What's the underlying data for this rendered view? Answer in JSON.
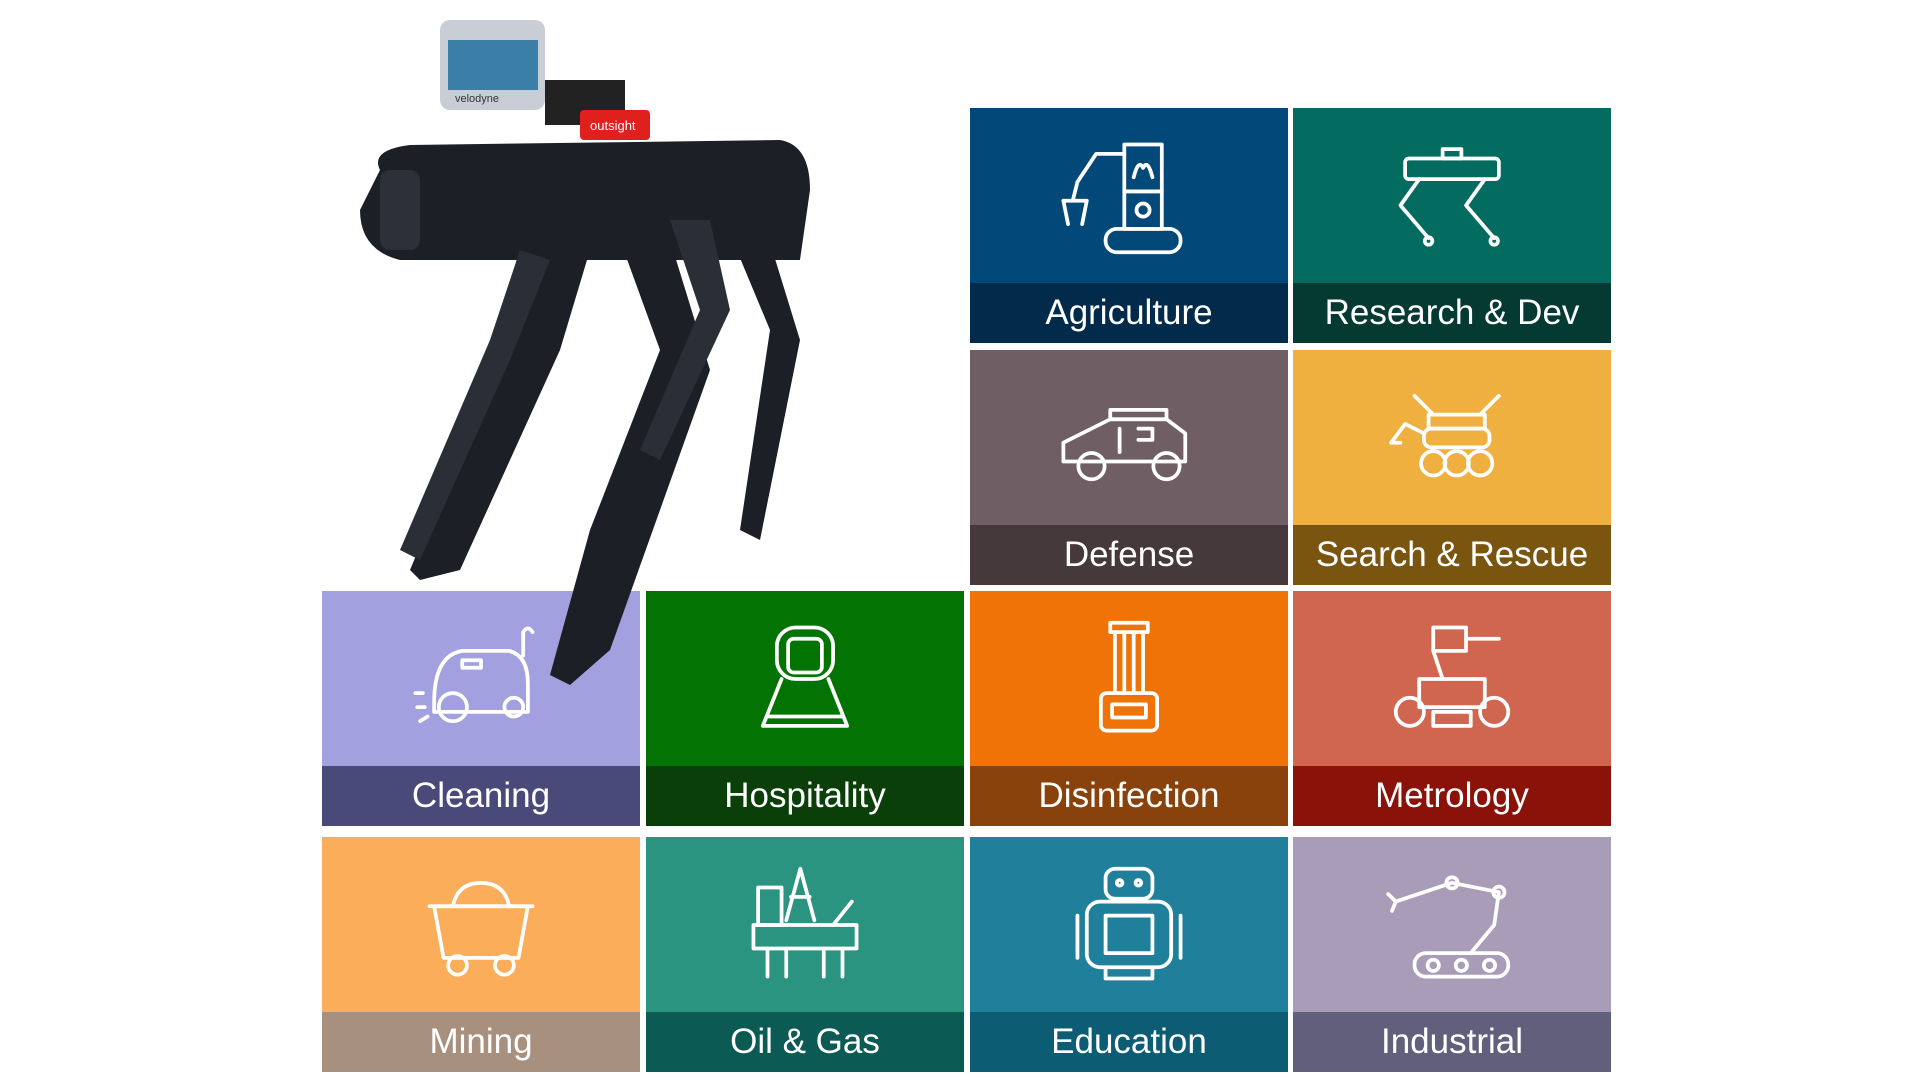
{
  "robot": {
    "lidar_brand": "velodyne",
    "sensor_brand": "outsight"
  },
  "tiles": [
    {
      "label": "Agriculture",
      "icon": "agriculture-robot-icon",
      "color": "#02497a",
      "band": "#022a4a"
    },
    {
      "label": "Research & Dev",
      "icon": "quadruped-robot-icon",
      "color": "#036b5f",
      "band": "#053a32"
    },
    {
      "label": "Defense",
      "icon": "military-vehicle-icon",
      "color": "#6f5f64",
      "band": "#45393c"
    },
    {
      "label": "Search & Rescue",
      "icon": "rover-robot-icon",
      "color": "#f0b040",
      "band": "#7a5510"
    },
    {
      "label": "Cleaning",
      "icon": "cleaning-robot-icon",
      "color": "#a3a0e0",
      "band": "#4a4a7a"
    },
    {
      "label": "Hospitality",
      "icon": "service-robot-icon",
      "color": "#037303",
      "band": "#0a3f0a"
    },
    {
      "label": "Disinfection",
      "icon": "uv-lamp-robot-icon",
      "color": "#f07308",
      "band": "#8a420c"
    },
    {
      "label": "Metrology",
      "icon": "measuring-robot-icon",
      "color": "#d06650",
      "band": "#8a1208"
    },
    {
      "label": "Mining",
      "icon": "mine-cart-icon",
      "color": "#fbad5a",
      "band": "#a8907e"
    },
    {
      "label": "Oil & Gas",
      "icon": "oil-rig-icon",
      "color": "#2a9480",
      "band": "#0c5a54"
    },
    {
      "label": "Education",
      "icon": "humanoid-robot-icon",
      "color": "#20809c",
      "band": "#0c5c74"
    },
    {
      "label": "Industrial",
      "icon": "industrial-arm-icon",
      "color": "#a89cb8",
      "band": "#625f7c"
    }
  ]
}
